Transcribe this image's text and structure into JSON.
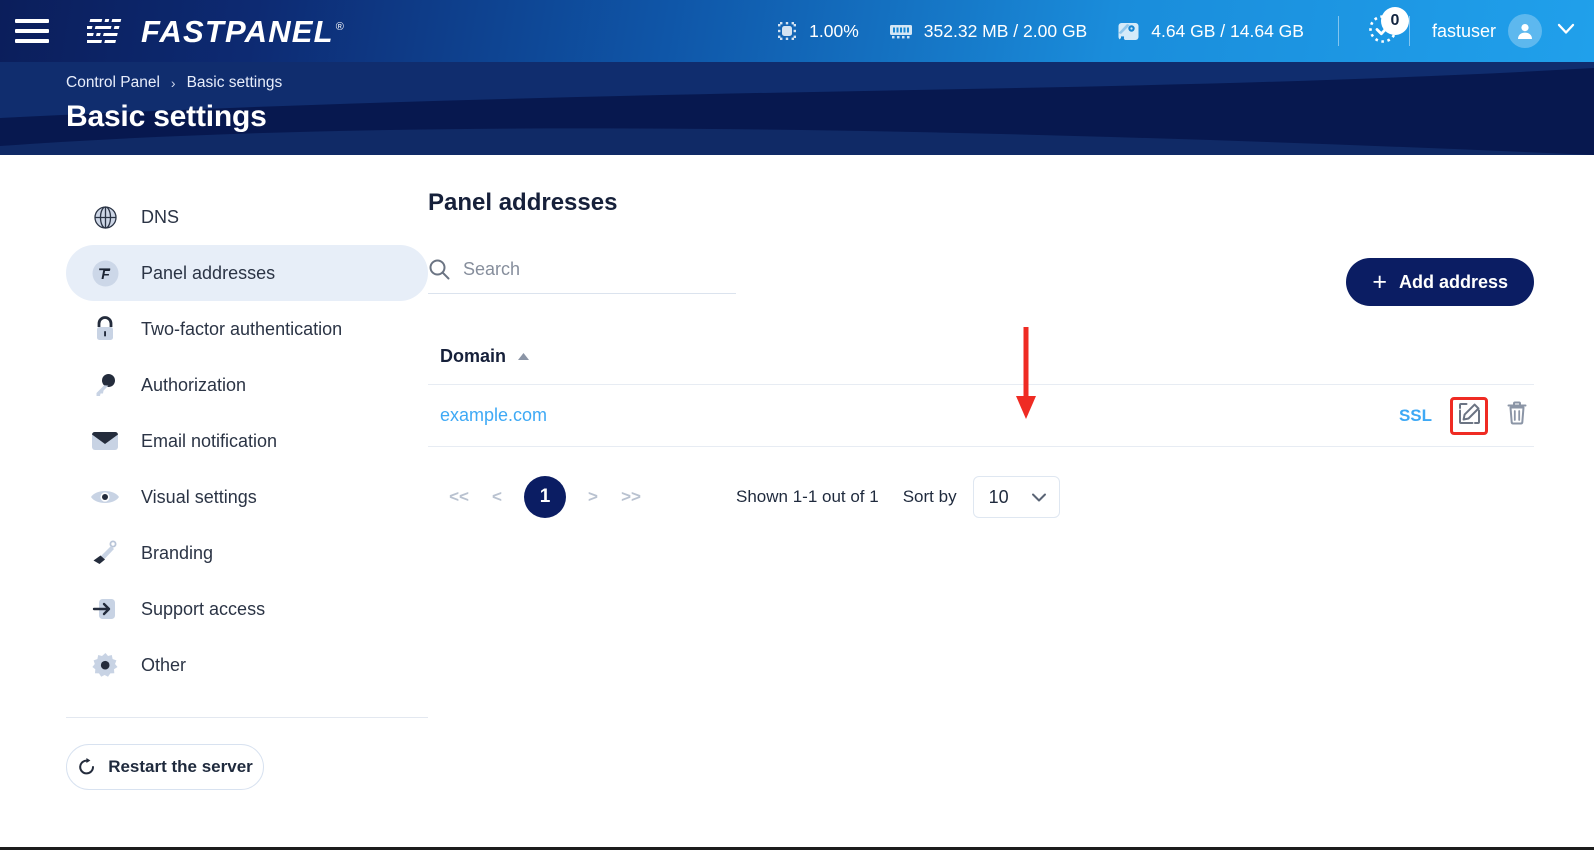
{
  "topbar": {
    "menu_icon": "hamburger-icon",
    "brand_name": "FASTPANEL",
    "brand_registered": "®",
    "stats": [
      {
        "icon": "cpu-icon",
        "value": "1.00%"
      },
      {
        "icon": "ram-icon",
        "value": "352.32 MB / 2.00 GB"
      },
      {
        "icon": "disk-icon",
        "value": "4.64 GB / 14.64 GB"
      }
    ],
    "notifications": {
      "icon": "task-check-icon",
      "count": "0"
    },
    "user": {
      "name": "fastuser",
      "avatar_icon": "user-avatar-icon",
      "chevron_icon": "chevron-down-icon"
    }
  },
  "banner": {
    "breadcrumb": {
      "root": "Control Panel",
      "separator": "›",
      "current": "Basic settings"
    },
    "title": "Basic settings"
  },
  "sidebar": {
    "items": [
      {
        "label": "DNS",
        "icon": "globe-icon",
        "active": false
      },
      {
        "label": "Panel addresses",
        "icon": "fastpanel-f-icon",
        "active": true
      },
      {
        "label": "Two-factor authentication",
        "icon": "lock-icon",
        "active": false
      },
      {
        "label": "Authorization",
        "icon": "key-icon",
        "active": false
      },
      {
        "label": "Email notification",
        "icon": "envelope-icon",
        "active": false
      },
      {
        "label": "Visual settings",
        "icon": "eye-icon",
        "active": false
      },
      {
        "label": "Branding",
        "icon": "paint-brush-icon",
        "active": false
      },
      {
        "label": "Support access",
        "icon": "arrow-right-box-icon",
        "active": false
      },
      {
        "label": "Other",
        "icon": "gear-icon",
        "active": false
      }
    ],
    "restart_button": {
      "label": "Restart the server",
      "icon": "restart-icon"
    }
  },
  "main": {
    "title": "Panel addresses",
    "search": {
      "placeholder": "Search",
      "value": "",
      "icon": "search-icon"
    },
    "add_button": {
      "label": "Add address",
      "icon": "plus-icon"
    },
    "table": {
      "columns": [
        {
          "label": "Domain",
          "sort": "asc",
          "sort_icon": "caret-up-icon"
        }
      ],
      "rows": [
        {
          "domain": "example.com",
          "ssl_label": "SSL",
          "edit_icon": "edit-pencil-icon",
          "delete_icon": "trash-icon"
        }
      ]
    },
    "pagination": {
      "first": "<<",
      "prev": "<",
      "current_page": "1",
      "next": ">",
      "last": ">>",
      "shown_text": "Shown 1-1 out of 1",
      "sort_by_label": "Sort by",
      "per_page_value": "10",
      "per_page_icon": "chevron-down-icon"
    }
  },
  "annotation": {
    "type": "red-arrow",
    "color": "#ef2b23",
    "target": "edit-pencil-icon"
  },
  "colors": {
    "brand_dark": "#0b1d63",
    "banner": "#07184f",
    "accent_blue": "#3ea9f5",
    "annotation_red": "#ef2b23",
    "active_nav_bg": "#e7eef8"
  }
}
